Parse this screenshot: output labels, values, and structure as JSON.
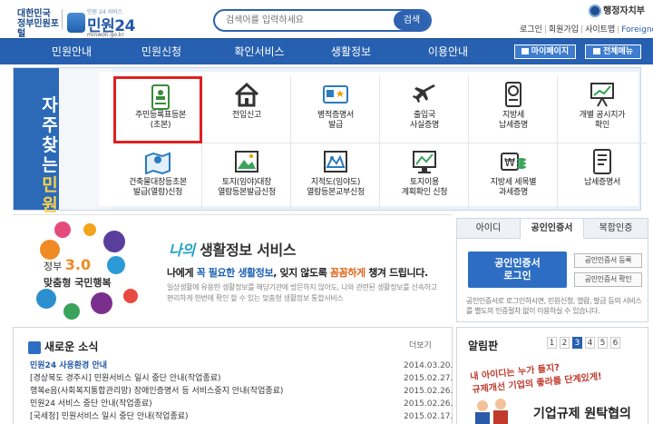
{
  "header": {
    "logo_left_line1": "대한민국",
    "logo_left_line2": "정부민원포털",
    "logo_small": "민원 24 서비스",
    "logo_main": "민원24",
    "logo_url": "minwon.go.kr",
    "search_placeholder": "검색어를 입력하세요",
    "search_button": "검색",
    "ministry": "행정자치부",
    "util_links": [
      "로그인",
      "회원가입",
      "사이트맵",
      "Foreigner"
    ]
  },
  "nav": {
    "items": [
      "민원안내",
      "민원신청",
      "확인서비스",
      "생활정보",
      "이용안내"
    ],
    "mypage": "마이페이지",
    "all_services": "전체메뉴"
  },
  "frequent": {
    "vertical_label": [
      "자",
      "주",
      "찾",
      "는",
      "민",
      "원"
    ],
    "items": [
      {
        "label": "주민등록표등본\n(초본)",
        "icon": "resident-registration-icon"
      },
      {
        "label": "전입신고",
        "icon": "house-icon"
      },
      {
        "label": "병적증명서\n발급",
        "icon": "military-record-icon"
      },
      {
        "label": "출입국\n사실증명",
        "icon": "airplane-icon"
      },
      {
        "label": "지방세\n납세증명",
        "icon": "tax-certificate-icon"
      },
      {
        "label": "개별 공시지가\n확인",
        "icon": "presentation-chart-icon"
      },
      {
        "label": "건축물대장등초본\n발급(열람)신청",
        "icon": "map-pin-icon"
      },
      {
        "label": "토지(임야)대장\n열람등본발급신청",
        "icon": "land-photo-icon"
      },
      {
        "label": "지적도(임야도)\n열람등본교부신청",
        "icon": "cadastral-map-icon"
      },
      {
        "label": "토지이용\n계획확인 신청",
        "icon": "land-use-monitor-icon"
      },
      {
        "label": "지방세 세목별\n과세증명",
        "icon": "won-coins-icon"
      },
      {
        "label": "납세증명서",
        "icon": "tax-document-icon"
      }
    ]
  },
  "banner": {
    "gov_line1": "정부",
    "gov_version": "3.0",
    "gov_line2": "맞춤형 국민행복",
    "title_hl": "나의",
    "title_rest": " 생활정보 서비스",
    "sub_1": "나에게 ",
    "sub_hl1": "꼭 필요한 생활정보",
    "sub_2": ", 잊지 않도록 ",
    "sub_hl2": "꼼꼼하게",
    "sub_3": " 챙겨 드립니다.",
    "desc": "일상생활에 유용한 생활정보를 해당기관에 방문하지 않아도, 나와 관련된 생활정보를 신속하고 편리하게 한번에 확인 할 수 있는 맞춤형 생활정보 통합서비스"
  },
  "login": {
    "tabs": [
      "아이디",
      "공인인증서",
      "복합인증"
    ],
    "active_tab": 1,
    "cert_button_line1": "공인인증서",
    "cert_button_line2": "로그인",
    "register_button": "공인인증서 등록",
    "test_button": "공인인증서 확인",
    "note": "공인인증서로 로그인하시면, 민원신청, 열람, 발급 등의 서비스를 별도의 인증절차 없이 이용하실 수 있습니다."
  },
  "news": {
    "title": "새로운 소식",
    "more": "더보기",
    "rows": [
      {
        "title": "민원24 사용환경 안내",
        "date": "2014.03.20."
      },
      {
        "title": "[경상북도 경주시] 민원서비스 일시 중단 안내(작업종료)",
        "date": "2015.02.27."
      },
      {
        "title": "행복e음(사회복지통합관리망) 장애인증명서 등 서비스중지 안내(작업종료)",
        "date": "2015.02.26."
      },
      {
        "title": "민원24 서비스 중단 안내(작업종료)",
        "date": "2015.02.26."
      },
      {
        "title": "[국세청] 민원서비스 일시 중단 안내(작업종료)",
        "date": "2015.02.17."
      }
    ]
  },
  "board": {
    "title": "알림판",
    "pages": [
      "1",
      "2",
      "3",
      "4",
      "5",
      "6"
    ],
    "current_page": 3,
    "banner_line1": "내 아이디는 누가 들지?",
    "banner_line2": "규제개선 기업의 좋라를 단계있게!",
    "banner_main": "기업규제 원탁협의"
  }
}
